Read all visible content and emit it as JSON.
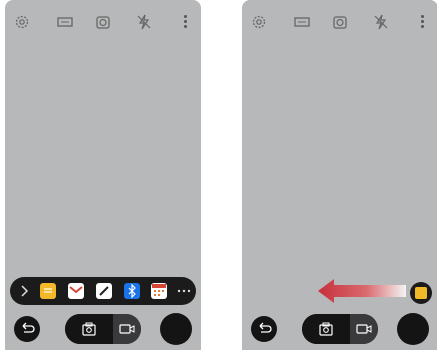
{
  "screens": [
    {
      "id": "left",
      "top_icons": [
        "settings-icon",
        "aspect-ratio-icon",
        "timer-icon",
        "flash-off-icon",
        "more-vert-icon"
      ],
      "dock": {
        "visible": true,
        "items": [
          "chevron-right-icon",
          "memo-app-icon",
          "gmail-app-icon",
          "pen-app-icon",
          "bluetooth-app-icon",
          "calendar-app-icon",
          "more-horiz-icon"
        ]
      },
      "bottom": [
        "back-icon",
        "photo-mode-icon",
        "video-mode-icon",
        "shutter-button"
      ]
    },
    {
      "id": "right",
      "top_icons": [
        "settings-icon",
        "aspect-ratio-icon",
        "timer-icon",
        "flash-off-icon",
        "more-vert-icon"
      ],
      "swipe_hint": {
        "direction": "left",
        "color": "#c8303a"
      },
      "mini_app": "memo-app-icon",
      "bottom": [
        "back-icon",
        "photo-mode-icon",
        "video-mode-icon",
        "shutter-button"
      ]
    }
  ],
  "colors": {
    "viewfinder": "#b7b8ba",
    "bar": "#1b1b1b",
    "memo": "#f1b928",
    "gmail": "#d44638",
    "bluetooth": "#1a73e8",
    "arrow": "#c8303a"
  }
}
